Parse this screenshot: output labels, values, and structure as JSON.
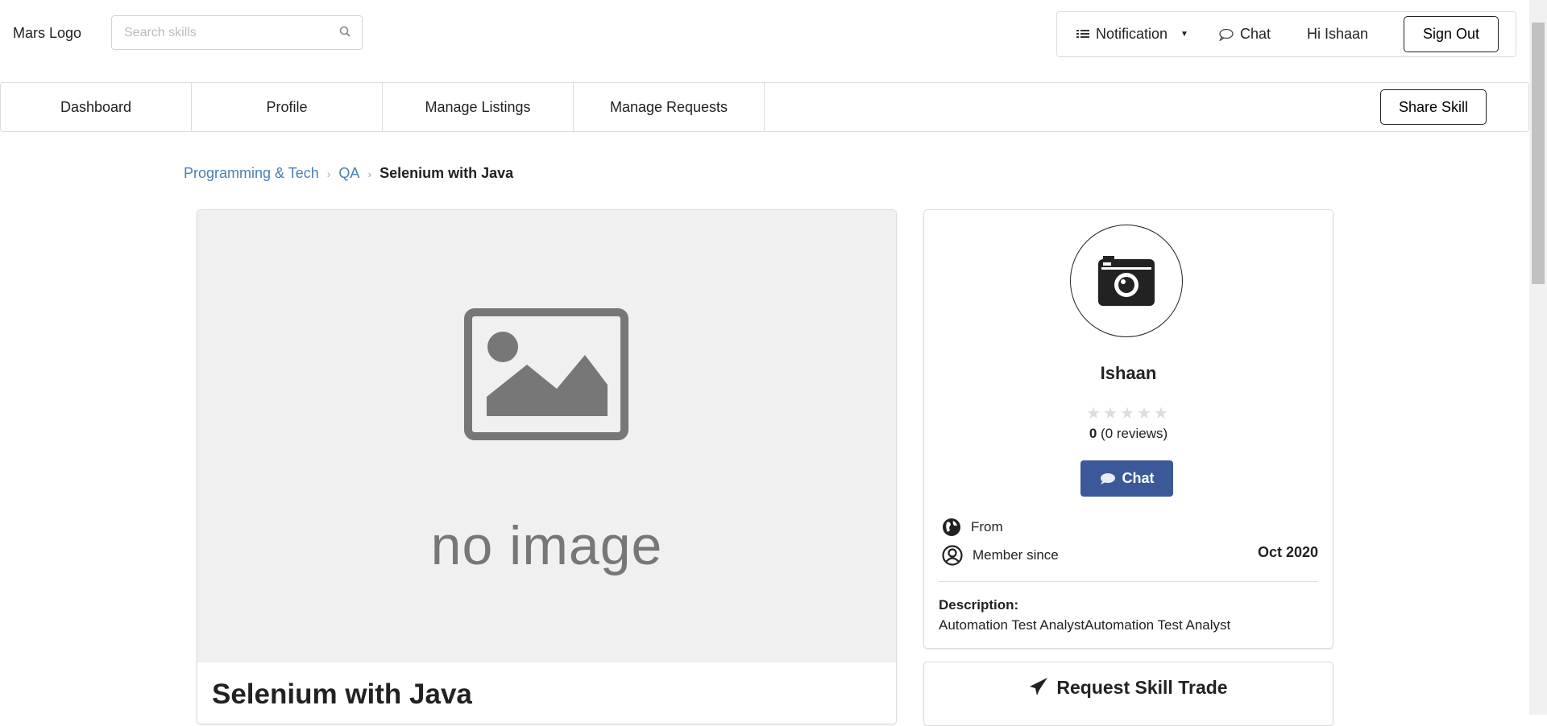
{
  "header": {
    "logo": "Mars Logo",
    "search_placeholder": "Search skills",
    "notification": "Notification",
    "chat": "Chat",
    "greeting": "Hi Ishaan",
    "sign_out": "Sign Out"
  },
  "nav": {
    "items": [
      "Dashboard",
      "Profile",
      "Manage Listings",
      "Manage Requests"
    ],
    "share_skill": "Share Skill"
  },
  "breadcrumb": [
    "Programming & Tech",
    "QA",
    "Selenium with Java"
  ],
  "listing": {
    "image_text": "no image",
    "title": "Selenium with Java"
  },
  "seller": {
    "name": "Ishaan",
    "rating": "0",
    "reviews": "(0 reviews)",
    "stars_filled": 0,
    "stars_total": 5,
    "chat_label": "Chat",
    "from_label": "From",
    "member_since_label": "Member since",
    "member_since_value": "Oct 2020",
    "description_label": "Description:",
    "description": "Automation Test AnalystAutomation Test Analyst"
  },
  "request_trade": "Request Skill Trade",
  "colors": {
    "link": "#4a7fb5",
    "chat_button": "#3b5998"
  }
}
